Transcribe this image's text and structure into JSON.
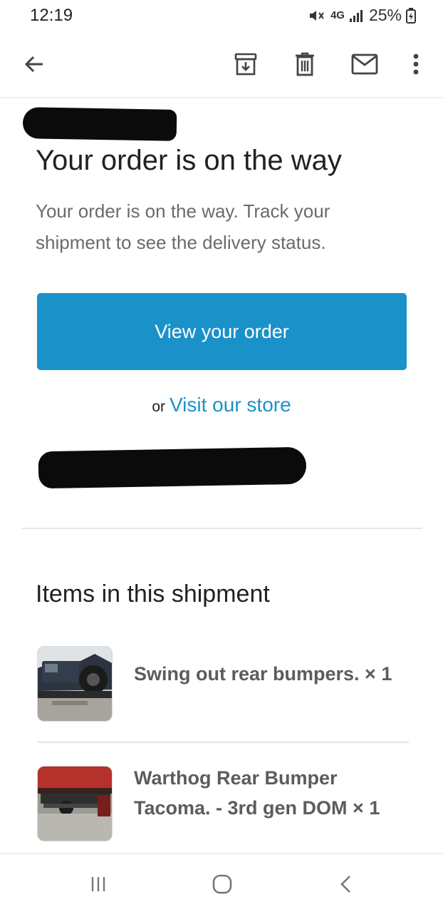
{
  "status_bar": {
    "time": "12:19",
    "network": "4G",
    "battery": "25%"
  },
  "toolbar": {
    "back_icon": "arrow-left-icon",
    "archive_icon": "archive-icon",
    "delete_icon": "trash-icon",
    "mark_unread_icon": "mail-icon",
    "more_icon": "more-vert-icon"
  },
  "email": {
    "title": "Your order is on the way",
    "subtitle": "Your order is on the way. Track your shipment to see the delivery status.",
    "primary_button": "View your order",
    "or_text": "or",
    "store_link": "Visit our store"
  },
  "shipment": {
    "section_title": "Items in this shipment",
    "items": [
      {
        "name": "Swing out rear bumpers. × 1"
      },
      {
        "name": "Warthog Rear Bumper Tacoma. - 3rd gen DOM × 1"
      }
    ]
  },
  "colors": {
    "accent": "#1b91c9",
    "text": "#202124",
    "muted_text": "#6b6b6b",
    "redaction": "#0b0b0b"
  }
}
